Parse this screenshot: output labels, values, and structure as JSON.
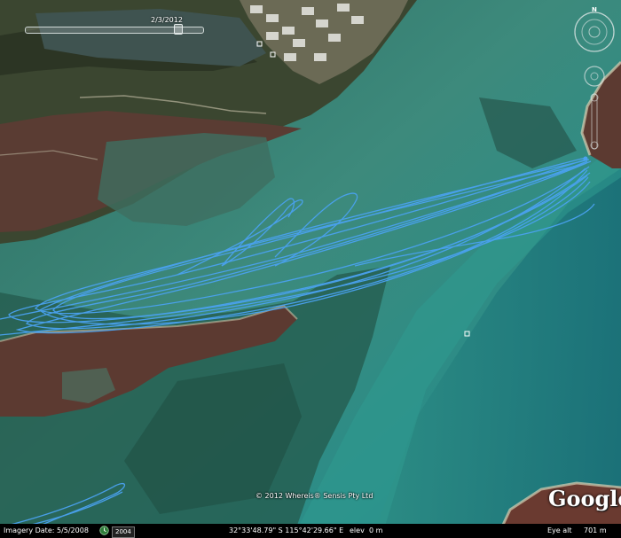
{
  "timeslider": {
    "date_label": "2/3/2012"
  },
  "copyright": "© 2012 Whereis® Sensis Pty Ltd",
  "logo": "Google",
  "status_bar": {
    "imagery_date": "Imagery Date: 5/5/2008",
    "history_year": "2004",
    "coordinates": "32°33'48.79\" S 115°42'29.66\" E",
    "elev_label": "elev",
    "elev_value": "0 m",
    "eye_alt_label": "Eye alt",
    "eye_alt_value": "701 m"
  },
  "colors": {
    "water_shallow": "#3f8f86",
    "water_deep": "#1d6e75",
    "land_wetland": "#5b3f34",
    "vegetation": "#3e4a31",
    "track": "#4aa2f0"
  },
  "icons": [
    "compass-icon",
    "look-joystick-icon",
    "move-joystick-icon",
    "zoom-slider-icon",
    "history-clock-icon"
  ]
}
